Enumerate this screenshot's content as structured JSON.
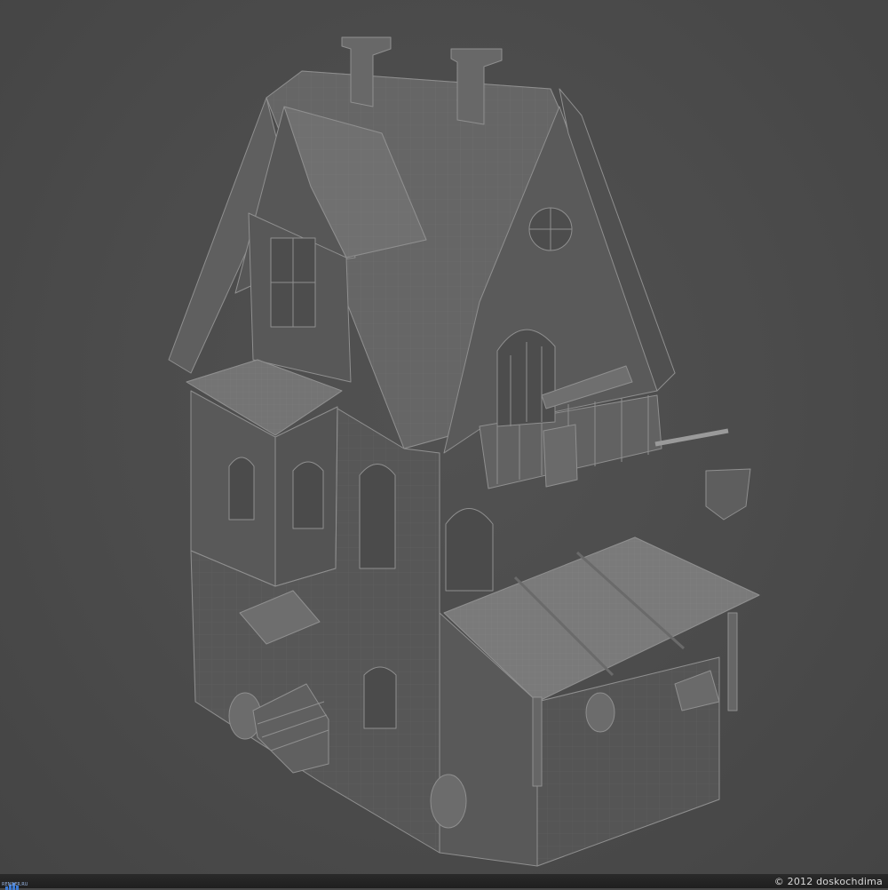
{
  "image": {
    "subject": "3D wireframe render of a stylized medieval house",
    "background_color": "#4a4a4a",
    "model_color": "#5c5c5c",
    "wire_color": "#8d8d8d"
  },
  "footer": {
    "credit": "© 2012 doskochdima",
    "logo_text": "RENDER.RU",
    "logo_color": "#3d7bd6"
  }
}
